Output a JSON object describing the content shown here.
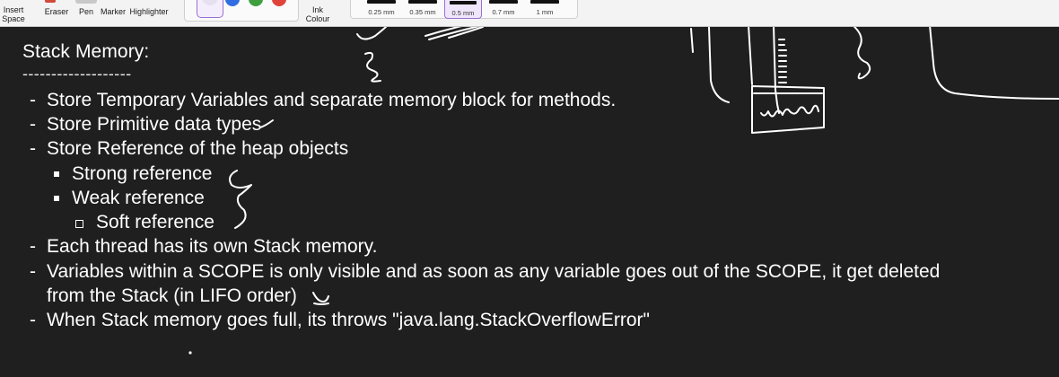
{
  "toolbar": {
    "insert_space": "Insert Space",
    "eraser": "Eraser",
    "pen": "Pen",
    "marker": "Marker",
    "highlighter": "Highlighter",
    "ink_colour": "Ink Colour",
    "thicknesses": [
      "0.25 mm",
      "0.35 mm",
      "0.5 mm",
      "0.7 mm",
      "1 mm"
    ],
    "selected_thickness": "0.5 mm",
    "colours": {
      "selected": "#e6e0f0",
      "blue": "#2f6de0",
      "green": "#3d9f3d",
      "red": "#e0433b"
    }
  },
  "note": {
    "heading": "Stack Memory:",
    "rule": "-------------------",
    "bullet_marker": "-",
    "items": [
      "Store Temporary Variables and separate memory block for methods.",
      "Store Primitive data types",
      "Store Reference of the heap objects",
      "Strong reference",
      "Weak reference",
      "Soft reference",
      "Each thread has its own Stack memory.",
      "Variables within a SCOPE is only visible and as soon as any variable goes out of the SCOPE, it get deleted",
      "from the Stack (in LIFO order)",
      "When Stack memory goes full, its throws \"java.lang.StackOverflowError\""
    ]
  }
}
